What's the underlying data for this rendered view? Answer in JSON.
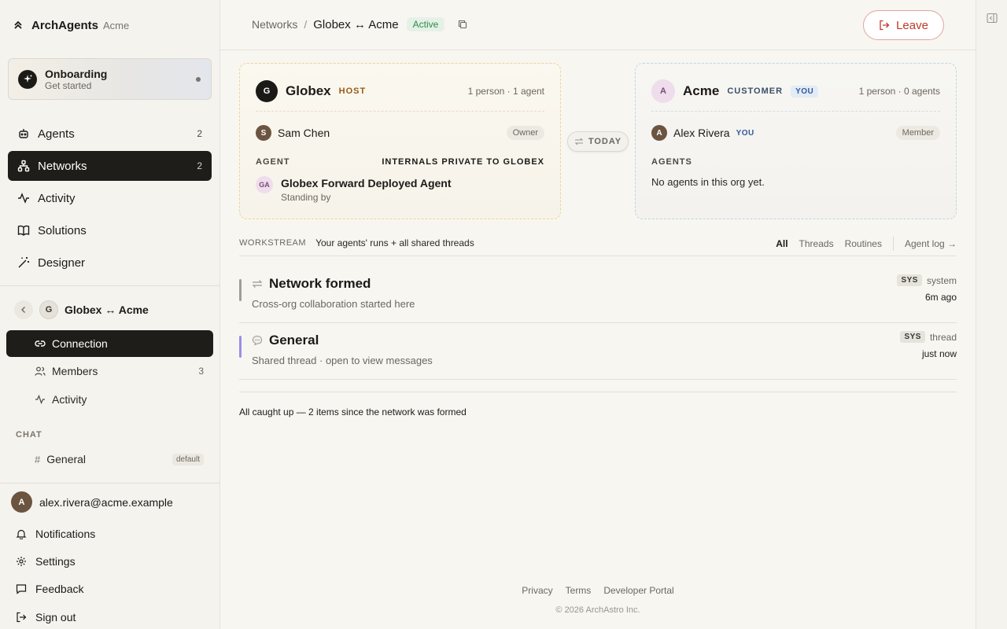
{
  "brand": {
    "name": "ArchAgents",
    "org": "Acme"
  },
  "onboarding": {
    "title": "Onboarding",
    "subtitle": "Get started"
  },
  "nav": [
    {
      "label": "Agents",
      "count": "2",
      "icon": "robot-icon"
    },
    {
      "label": "Networks",
      "count": "2",
      "icon": "network-icon",
      "active": true
    },
    {
      "label": "Activity",
      "count": "",
      "icon": "activity-icon"
    },
    {
      "label": "Solutions",
      "count": "",
      "icon": "book-icon"
    },
    {
      "label": "Designer",
      "count": "",
      "icon": "wand-icon"
    }
  ],
  "network": {
    "avatar": "G",
    "title": "Globex ↔ Acme",
    "subnav": [
      {
        "label": "Connection",
        "count": "",
        "active": true
      },
      {
        "label": "Members",
        "count": "3"
      },
      {
        "label": "Activity",
        "count": ""
      }
    ]
  },
  "chat": {
    "section_label": "CHAT",
    "channel": "General",
    "tag": "default"
  },
  "user": {
    "avatar": "A",
    "email": "alex.rivera@acme.example"
  },
  "footer_nav": [
    "Notifications",
    "Settings",
    "Feedback",
    "Sign out"
  ],
  "breadcrumb": {
    "root": "Networks",
    "separator": "/",
    "current": "Globex ↔ Acme",
    "status": "Active"
  },
  "leave_label": "Leave",
  "host_card": {
    "avatar": "G",
    "name": "Globex",
    "role": "HOST",
    "meta": "1 person · 1 agent",
    "person": {
      "avatar": "S",
      "name": "Sam Chen",
      "role": "Owner"
    },
    "section_label": "AGENT",
    "section_note": "INTERNALS PRIVATE TO GLOBEX",
    "agent": {
      "avatar": "GA",
      "name": "Globex Forward Deployed Agent",
      "status": "Standing by"
    }
  },
  "connector": {
    "label": "TODAY"
  },
  "customer_card": {
    "avatar": "A",
    "name": "Acme",
    "role": "CUSTOMER",
    "you": "YOU",
    "meta": "1 person · 0 agents",
    "person": {
      "avatar": "A",
      "name": "Alex Rivera",
      "you": "YOU",
      "role": "Member"
    },
    "section_label": "AGENTS",
    "empty": "No agents in this org yet."
  },
  "workstream": {
    "label": "WORKSTREAM",
    "description": "Your agents' runs + all shared threads",
    "tabs": [
      "All",
      "Threads",
      "Routines"
    ],
    "agent_log": "Agent log →",
    "items": [
      {
        "title": "Network formed",
        "subtitle": "Cross-org collaboration started here",
        "badge": "SYS",
        "kind": "system",
        "time": "6m ago",
        "bar_color": "#a39c90",
        "icon": "swap-icon"
      },
      {
        "title": "General",
        "subtitle": "Shared thread · open to view messages",
        "badge": "SYS",
        "kind": "thread",
        "time": "just now",
        "bar_color": "#9b8ee8",
        "icon": "chat-bubble-icon"
      }
    ],
    "caught_up": "All caught up — 2 items since the network was formed"
  },
  "footer": {
    "links": [
      "Privacy",
      "Terms",
      "Developer Portal"
    ],
    "copyright": "© 2026 ArchAstro Inc."
  }
}
